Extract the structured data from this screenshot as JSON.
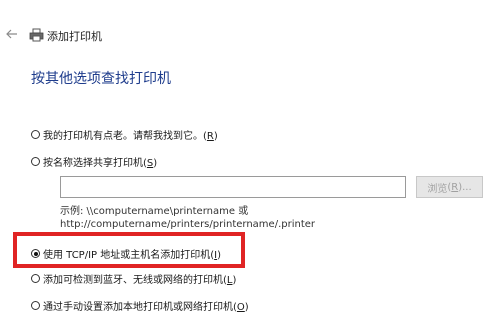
{
  "header": {
    "back_icon": "arrow-left-icon",
    "printer_icon": "printer-icon",
    "title": "添加打印机"
  },
  "page": {
    "heading": "按其他选项查找打印机"
  },
  "options": [
    {
      "label": "我的打印机有点老。请帮我找到它。",
      "hotkey": "R",
      "checked": false
    },
    {
      "label": "按名称选择共享打印机",
      "hotkey": "S",
      "checked": false
    },
    {
      "label": "使用 TCP/IP 地址或主机名添加打印机",
      "hotkey": "I",
      "checked": true
    },
    {
      "label": "添加可检测到蓝牙、无线或网络的打印机",
      "hotkey": "L",
      "checked": false
    },
    {
      "label": "通过手动设置添加本地打印机或网络打印机",
      "hotkey": "O",
      "checked": false
    }
  ],
  "shared_printer": {
    "value": "",
    "placeholder": "",
    "browse_label": "浏览",
    "browse_hotkey": "R",
    "example_line1": "示例: \\\\computername\\printername 或",
    "example_line2": "http://computername/printers/printername/.printer"
  },
  "highlight": {
    "color": "#e02424"
  }
}
